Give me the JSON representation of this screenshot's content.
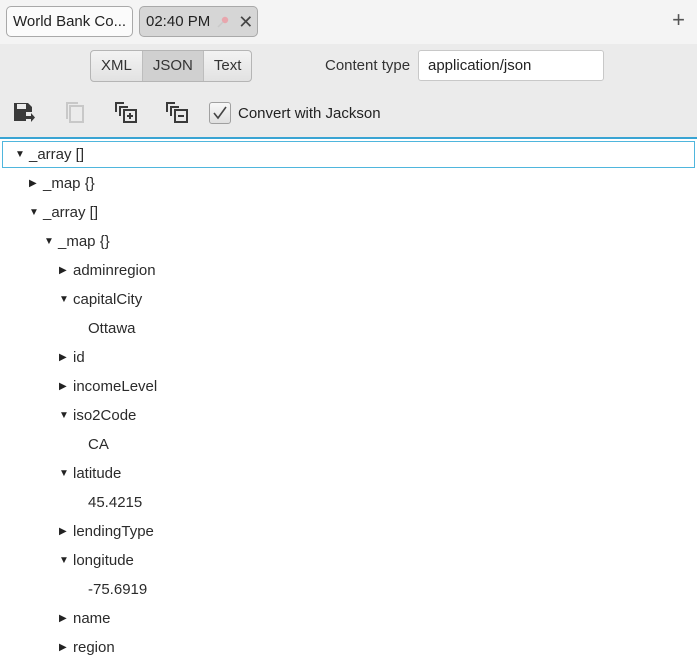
{
  "tabs": [
    {
      "label": "World Bank Co...",
      "active": false
    },
    {
      "label": "02:40 PM",
      "active": true,
      "pinned": true,
      "closable": true
    }
  ],
  "add_tab_label": "+",
  "format_modes": {
    "options": [
      "XML",
      "JSON",
      "Text"
    ],
    "selected": "JSON"
  },
  "content_type": {
    "label": "Content type",
    "value": "application/json"
  },
  "toolbar_icons": [
    "save-export-icon",
    "copy-icon",
    "expand-all-icon",
    "collapse-all-icon"
  ],
  "convert_with_jackson": {
    "label": "Convert with Jackson",
    "checked": true
  },
  "tree": [
    {
      "label": "_array []",
      "depth": 0,
      "expanded": true,
      "selected": true
    },
    {
      "label": "_map {}",
      "depth": 1,
      "expanded": false
    },
    {
      "label": "_array []",
      "depth": 1,
      "expanded": true
    },
    {
      "label": "_map {}",
      "depth": 2,
      "expanded": true
    },
    {
      "label": "adminregion",
      "depth": 3,
      "expanded": false
    },
    {
      "label": "capitalCity",
      "depth": 3,
      "expanded": true
    },
    {
      "label": "Ottawa",
      "depth": 4,
      "leaf": true
    },
    {
      "label": "id",
      "depth": 3,
      "expanded": false
    },
    {
      "label": "incomeLevel",
      "depth": 3,
      "expanded": false
    },
    {
      "label": "iso2Code",
      "depth": 3,
      "expanded": true
    },
    {
      "label": "CA",
      "depth": 4,
      "leaf": true
    },
    {
      "label": "latitude",
      "depth": 3,
      "expanded": true
    },
    {
      "label": "45.4215",
      "depth": 4,
      "leaf": true
    },
    {
      "label": "lendingType",
      "depth": 3,
      "expanded": false
    },
    {
      "label": "longitude",
      "depth": 3,
      "expanded": true
    },
    {
      "label": "-75.6919",
      "depth": 4,
      "leaf": true
    },
    {
      "label": "name",
      "depth": 3,
      "expanded": false
    },
    {
      "label": "region",
      "depth": 3,
      "expanded": false
    }
  ]
}
